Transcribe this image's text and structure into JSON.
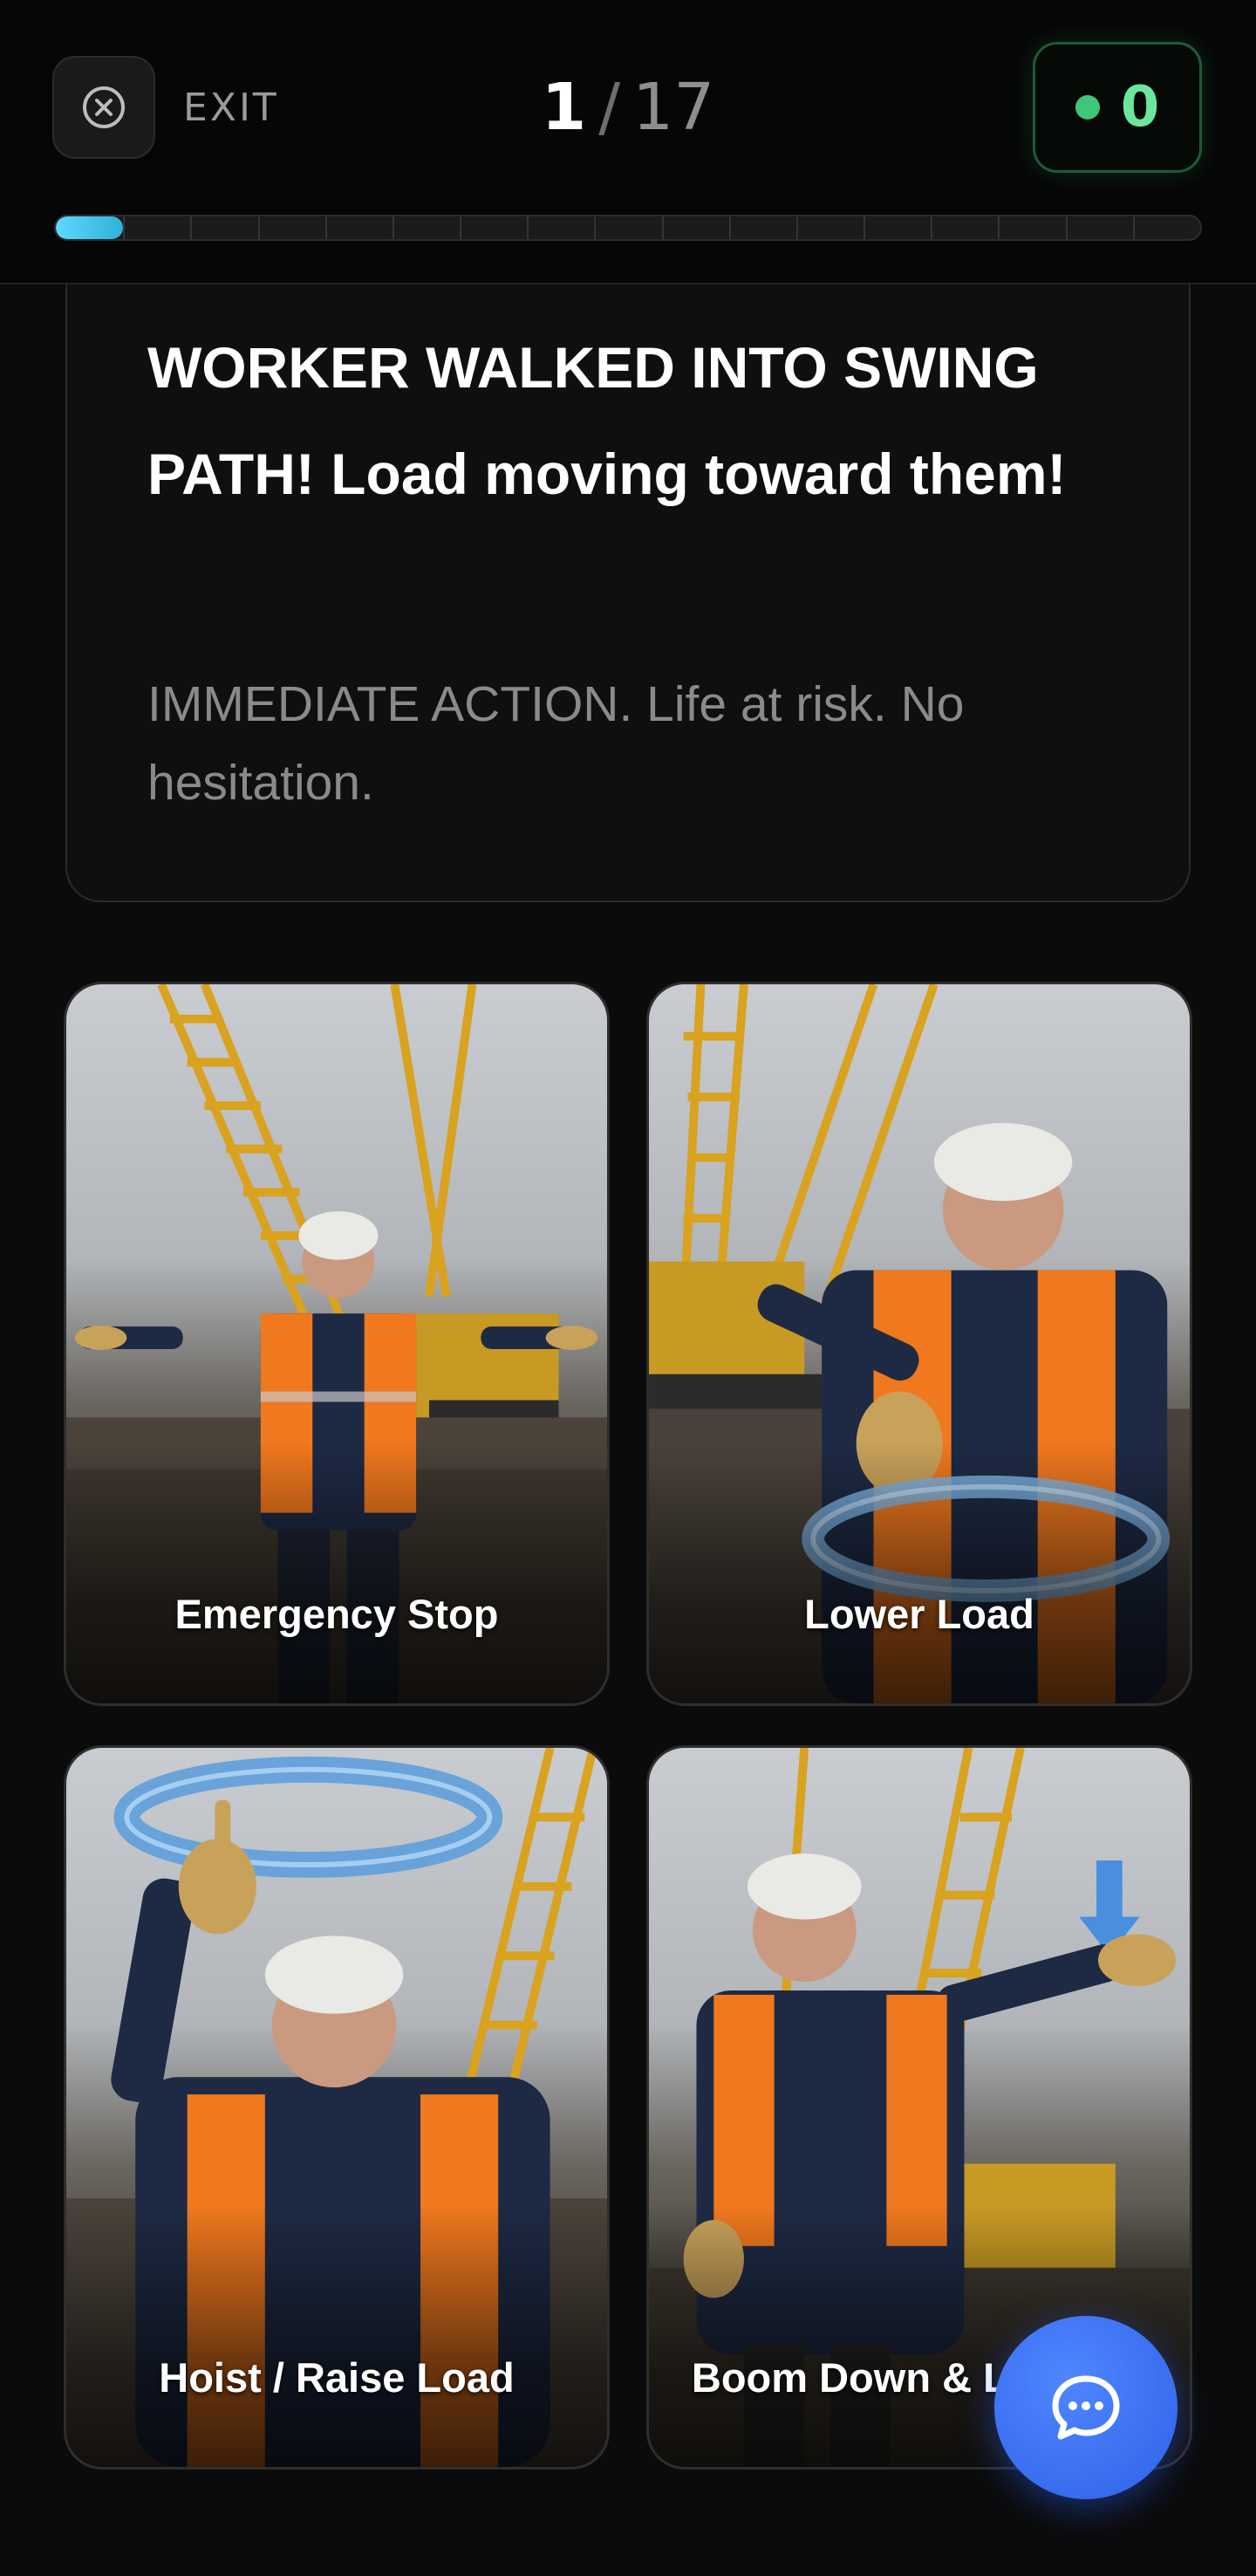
{
  "header": {
    "exit_label": "EXIT",
    "current": "1",
    "separator": "/",
    "total": "17",
    "score": "0",
    "progress": {
      "completed": 1,
      "total": 17
    }
  },
  "question": {
    "title": "WORKER WALKED INTO SWING PATH! Load moving toward them!",
    "subtitle": "IMMEDIATE ACTION. Life at risk. No hesitation."
  },
  "options": [
    {
      "label": "Emergency Stop",
      "image": "worker-arms-extended-image"
    },
    {
      "label": "Lower Load",
      "image": "worker-lower-load-image"
    },
    {
      "label": "Hoist / Raise Load",
      "image": "worker-hoist-image"
    },
    {
      "label": "Boom Down & Load Up",
      "image": "worker-boom-down-image"
    }
  ],
  "chat": {
    "icon": "chat-bubble-icon"
  },
  "colors": {
    "accent": "#5fd8ff",
    "score_green": "#6ce69c",
    "fab_blue": "#3a6ff0"
  }
}
